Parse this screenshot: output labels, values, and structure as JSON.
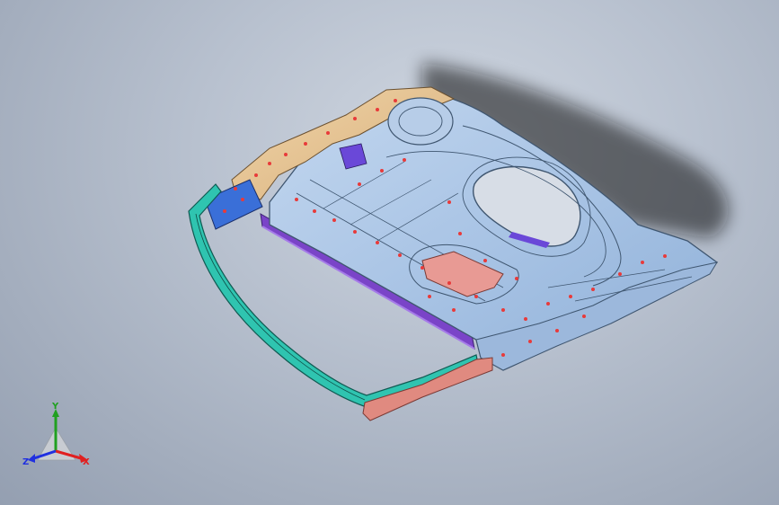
{
  "view": {
    "background_top": "#cfd6e0",
    "background_bottom": "#949fb1",
    "accent_colors": {
      "inner_panel": "#a8c4e4",
      "inner_panel_edge": "#3f5670",
      "upper_reinforcement": "#e8c898",
      "window_frame": "#2fc4b0",
      "beltline_strip": "#8a52d0",
      "lower_seal": "#e08a80",
      "hinge_bracket": "#3a6fd8",
      "weld_points": "#e83a3a"
    },
    "icons": [
      "triad-icon"
    ]
  },
  "triad": {
    "x_label": "X",
    "y_label": "Y",
    "z_label": "Z",
    "x_color": "#e02020",
    "y_color": "#20a020",
    "z_color": "#2030e0"
  }
}
